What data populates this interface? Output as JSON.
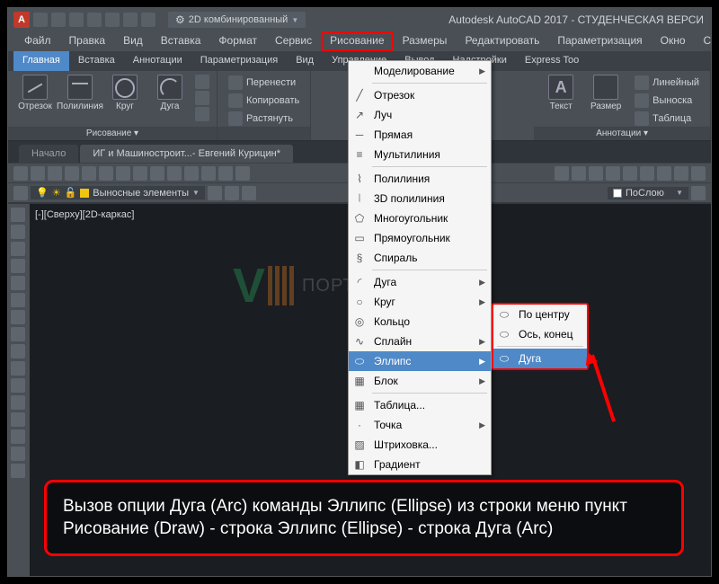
{
  "titlebar": {
    "workspace": "2D комбинированный",
    "app_title": "Autodesk AutoCAD 2017 - СТУДЕНЧЕСКАЯ ВЕРСИ"
  },
  "menubar": [
    "Файл",
    "Правка",
    "Вид",
    "Вставка",
    "Формат",
    "Сервис",
    "Рисование",
    "Размеры",
    "Редактировать",
    "Параметризация",
    "Окно",
    "Спра"
  ],
  "ribbon_tabs": [
    "Главная",
    "Вставка",
    "Аннотации",
    "Параметризация",
    "Вид",
    "Управление",
    "Вывод",
    "Надстройки",
    "Express Too"
  ],
  "ribbon": {
    "draw": {
      "title": "Рисование ▾",
      "items": [
        {
          "icon": "line",
          "label": "Отрезок"
        },
        {
          "icon": "poly",
          "label": "Полилиния"
        },
        {
          "icon": "circ",
          "label": "Круг"
        },
        {
          "icon": "arc",
          "label": "Дуга"
        }
      ]
    },
    "modify": {
      "items": [
        {
          "label": "Перенести"
        },
        {
          "label": "Копировать"
        },
        {
          "label": "Растянуть"
        }
      ]
    },
    "annot": {
      "title": "Аннотации ▾",
      "text": "Текст",
      "dim": "Размер",
      "items": [
        {
          "label": "Линейный"
        },
        {
          "label": "Выноска"
        },
        {
          "label": "Таблица"
        }
      ]
    }
  },
  "doctabs": {
    "home": "Начало",
    "active": "ИГ и Машиностроит...- Евгений Курицин*"
  },
  "layer_dd": "Выносные элементы",
  "color_dd": "ПоСлою",
  "viewport": "[-][Сверху][2D-каркас]",
  "dropdown": {
    "header": "Моделирование",
    "g1": [
      "Отрезок",
      "Луч",
      "Прямая",
      "Мультилиния"
    ],
    "g2": [
      "Полилиния",
      "3D полилиния",
      "Многоугольник",
      "Прямоугольник",
      "Спираль"
    ],
    "g3": [
      "Дуга",
      "Круг",
      "Кольцо",
      "Сплайн",
      "Эллипс",
      "Блок"
    ],
    "g4": [
      "Таблица...",
      "Точка",
      "Штриховка...",
      "Градиент"
    ]
  },
  "submenu": [
    "По центру",
    "Ось, конец",
    "Дуга"
  ],
  "callout": "Вызов опции Дуга (Arc) команды Эллипс (Ellipse) из строки меню пункт Рисование (Draw) - строка Эллипс (Ellipse) - строка Дуга (Arc)",
  "watermark": "ПОРТАЛ"
}
